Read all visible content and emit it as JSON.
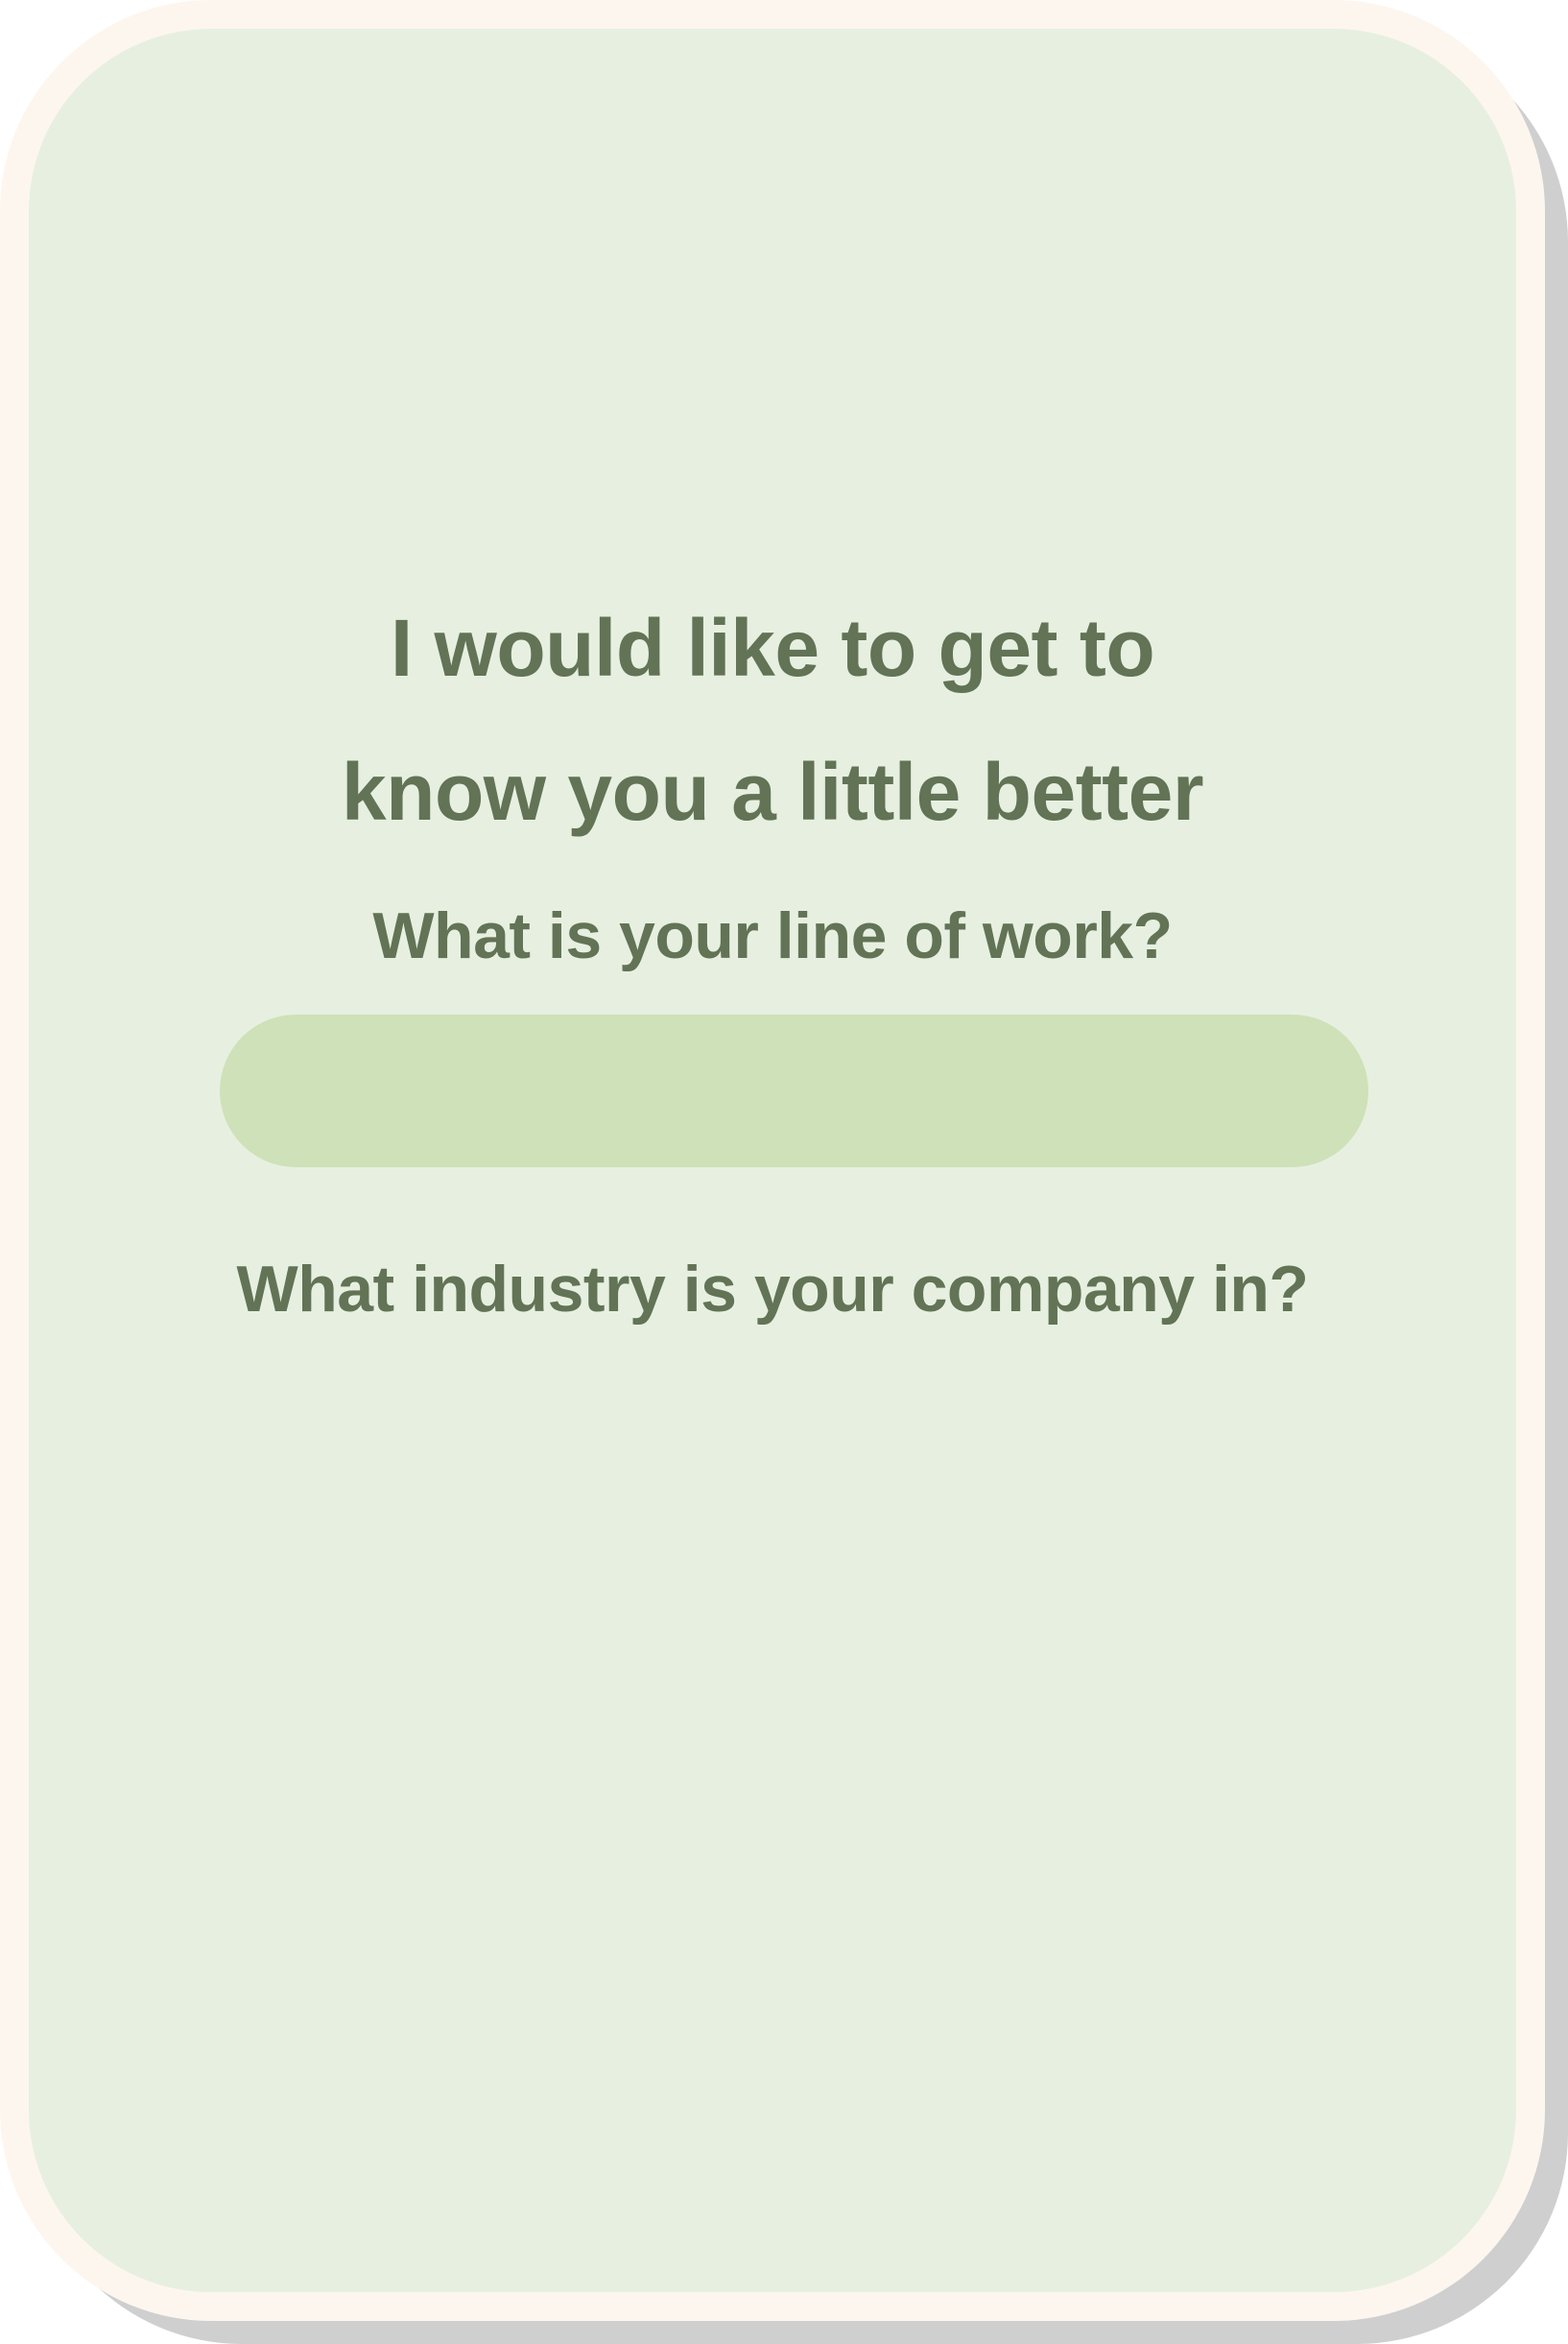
{
  "header": {
    "title_line1": "I would like to get to",
    "title_line2": "know you a little better"
  },
  "questions": {
    "line_of_work": "What is your line of work?",
    "line_of_work_value": "",
    "industry": "What industry is your company in?"
  },
  "colors": {
    "text": "#627356",
    "card_background": "#e7f0e0",
    "input_background": "#cfe1b8",
    "frame": "#fdf6ef"
  }
}
